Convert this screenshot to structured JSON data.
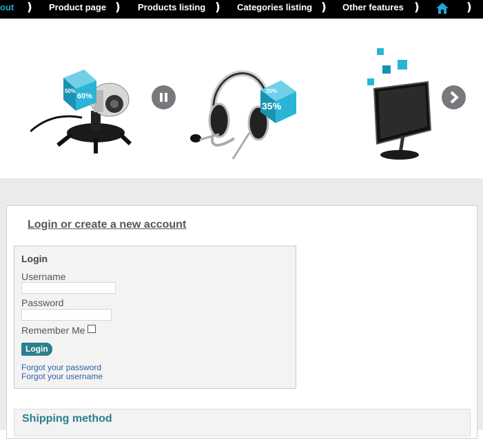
{
  "nav": {
    "items": [
      "out",
      "Product page",
      "Products listing",
      "Categories listing",
      "Other features"
    ],
    "separator": ")",
    "home_icon": "home-icon",
    "accent": "#23a6d5"
  },
  "banner": {
    "products": [
      {
        "name": "webcam",
        "badge_primary": "60%",
        "badge_secondary": "50%"
      },
      {
        "name": "headset",
        "badge_primary": "35%",
        "badge_secondary": "35%"
      },
      {
        "name": "monitor",
        "badge_primary": "",
        "badge_secondary": ""
      }
    ],
    "pause_icon": "pause-icon",
    "next_icon": "chevron-right-icon"
  },
  "account": {
    "heading": "Login or create a new account",
    "login": {
      "title": "Login",
      "username_label": "Username",
      "username_value": "",
      "password_label": "Password",
      "password_value": "",
      "remember_label": "Remember Me",
      "remember_checked": false,
      "button_label": "Login",
      "forgot_password": "Forgot your password",
      "forgot_username": "Forgot your username"
    },
    "shipping_title": "Shipping method",
    "accent": "#2b7f8e"
  }
}
